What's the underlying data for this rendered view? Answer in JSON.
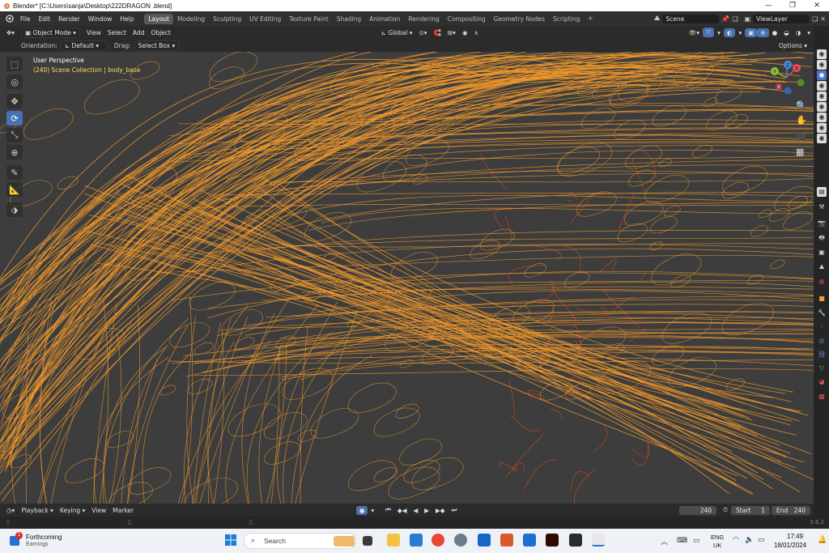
{
  "window": {
    "title": "Blender* [C:\\Users\\sanja\\Desktop\\222DRAGON .blend]",
    "minimize": "—",
    "maximize": "❐",
    "close": "✕"
  },
  "menu": {
    "items": [
      "File",
      "Edit",
      "Render",
      "Window",
      "Help"
    ]
  },
  "workspaces": {
    "tabs": [
      "Layout",
      "Modeling",
      "Sculpting",
      "UV Editing",
      "Texture Paint",
      "Shading",
      "Animation",
      "Rendering",
      "Compositing",
      "Geometry Nodes",
      "Scripting"
    ],
    "active": "Layout",
    "add": "+"
  },
  "scene": {
    "name": "Scene",
    "view_layer": "ViewLayer"
  },
  "header": {
    "mode": "Object Mode",
    "menus": [
      "View",
      "Select",
      "Add",
      "Object"
    ],
    "transform_orientation": "Global"
  },
  "tool_settings": {
    "orientation_label": "Orientation:",
    "orientation_value": "Default",
    "drag_label": "Drag:",
    "drag_value": "Select Box",
    "options": "Options"
  },
  "viewport": {
    "perspective": "User Perspective",
    "collection": "(240) Scene Collection | body_base",
    "gizmo": {
      "x": "X",
      "y": "Y",
      "z": "Z"
    }
  },
  "toolbar": {
    "tools": [
      "select-box",
      "cursor",
      "move",
      "rotate",
      "scale",
      "transform",
      "annotate",
      "measure",
      "add-cube"
    ],
    "active": "rotate"
  },
  "timeline": {
    "menus": [
      "Playback",
      "Keying",
      "View",
      "Marker"
    ],
    "current_frame": "240",
    "start_label": "Start",
    "start": "1",
    "end_label": "End",
    "end": "240"
  },
  "status": {
    "version": "3.6.2"
  },
  "taskbar": {
    "widget_title": "Forthcoming",
    "widget_subtitle": "Earnings",
    "widget_badge": "1",
    "search": "Search",
    "language": "ENG",
    "region": "UK",
    "time": "17:49",
    "date": "18/01/2024"
  },
  "colors": {
    "accent": "#4772b3",
    "wire_selected": "#f39a2c",
    "wire_other": "#c8461c",
    "collection_text": "#ffde58",
    "viewport_bg": "#3d3d3d"
  }
}
